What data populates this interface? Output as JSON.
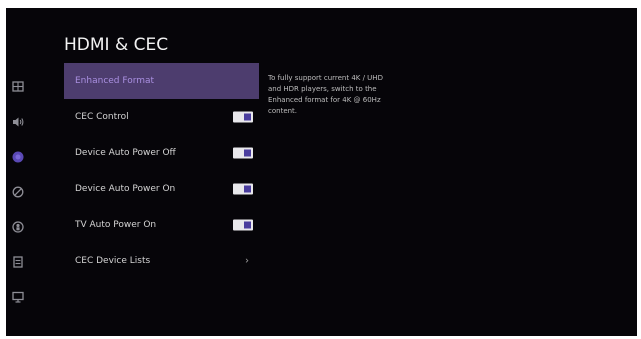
{
  "header": {
    "title": "HDMI & CEC"
  },
  "sidebar": {
    "items": [
      {
        "icon": "picture-icon",
        "active": false
      },
      {
        "icon": "sound-icon",
        "active": false
      },
      {
        "icon": "network-icon",
        "active": true
      },
      {
        "icon": "accessibility-icon",
        "active": false
      },
      {
        "icon": "privacy-icon",
        "active": false
      },
      {
        "icon": "storage-icon",
        "active": false
      },
      {
        "icon": "display-icon",
        "active": false
      }
    ]
  },
  "menu": {
    "items": [
      {
        "label": "Enhanced Format",
        "control": "none",
        "selected": true
      },
      {
        "label": "CEC Control",
        "control": "toggle",
        "on": true
      },
      {
        "label": "Device Auto Power Off",
        "control": "toggle",
        "on": true
      },
      {
        "label": "Device Auto Power On",
        "control": "toggle",
        "on": true
      },
      {
        "label": "TV Auto Power On",
        "control": "toggle",
        "on": true
      },
      {
        "label": "CEC Device Lists",
        "control": "chevron",
        "chevron": "›"
      }
    ]
  },
  "description": {
    "text": "To fully support current 4K / UHD and HDR players, switch to the Enhanced format for 4K @ 60Hz content."
  },
  "colors": {
    "background": "#060509",
    "selected_row": "#4d3d6e",
    "accent": "#4a3d9e",
    "toggle_track": "#e8e8ec"
  }
}
